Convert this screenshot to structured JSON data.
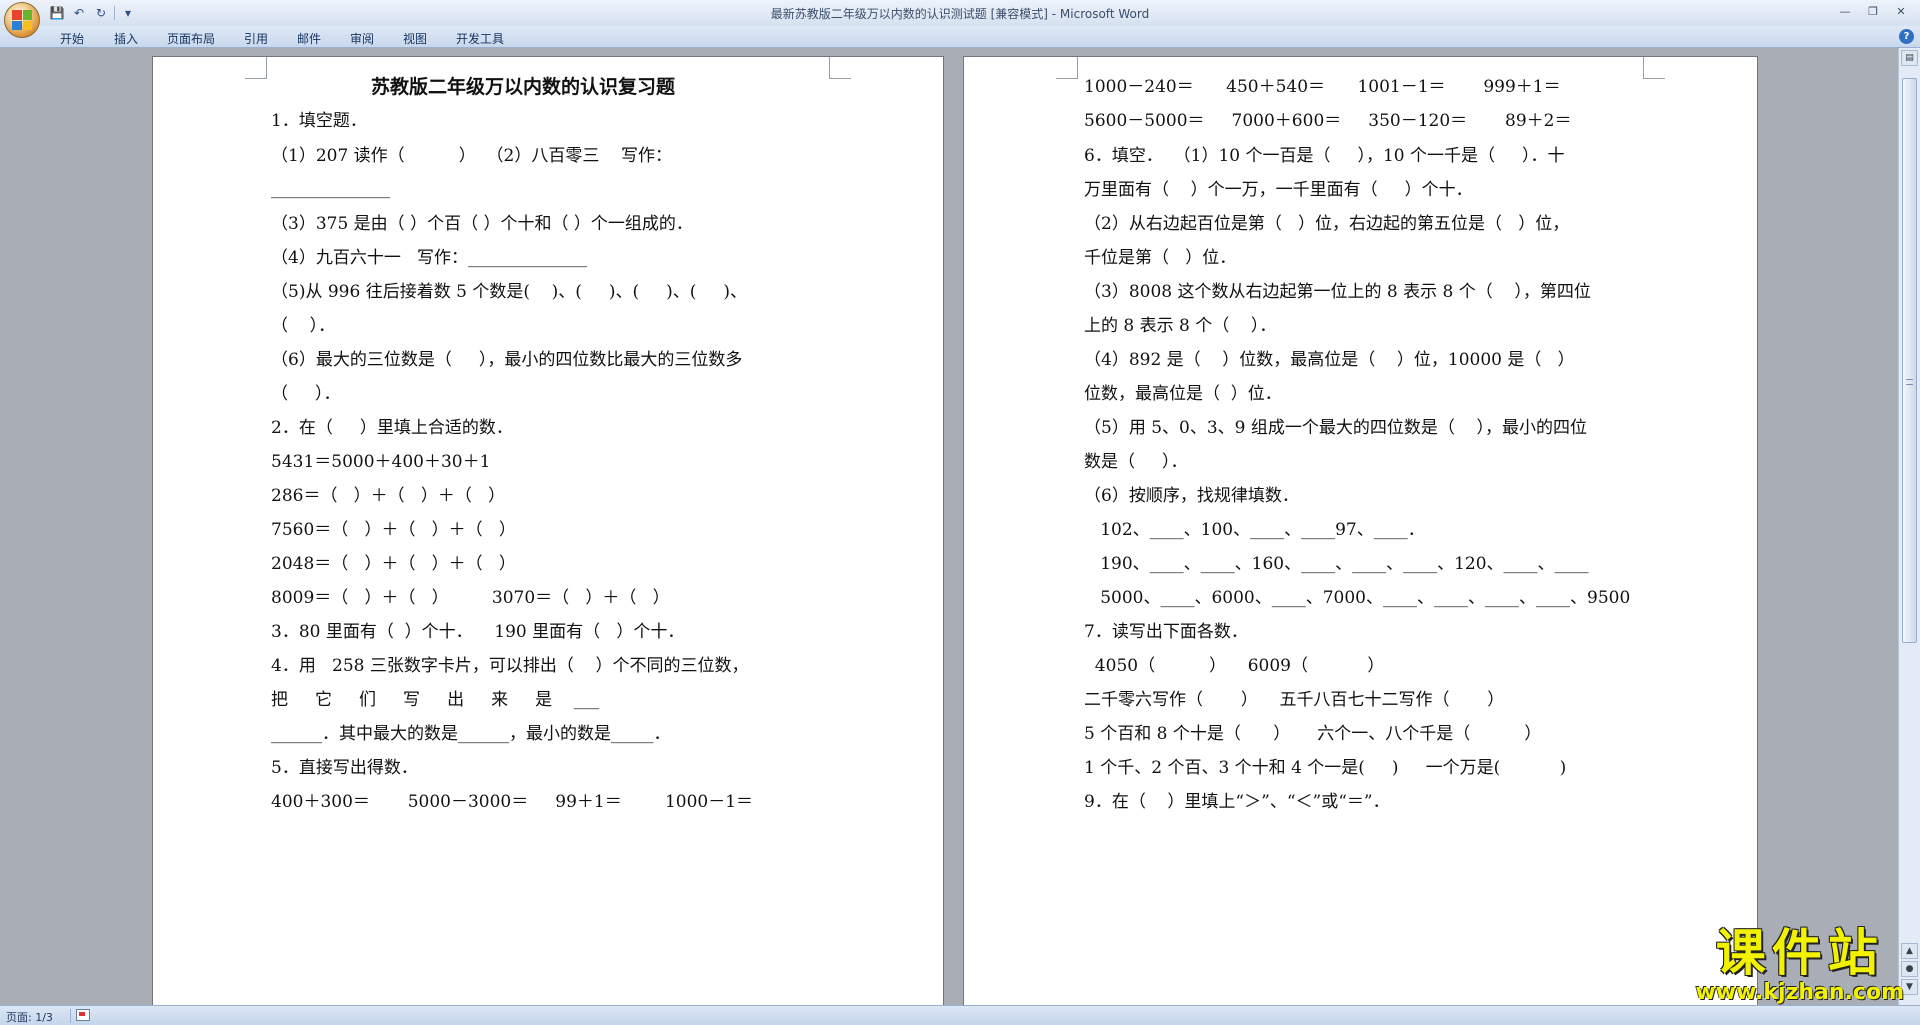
{
  "window": {
    "title": "最新苏教版二年级万以内数的认识测试题 [兼容模式] - Microsoft Word",
    "min_glyph": "—",
    "max_glyph": "❐",
    "close_glyph": "✕"
  },
  "quick_access": {
    "save_glyph": "💾",
    "undo_glyph": "↶",
    "redo_glyph": "↻",
    "more_glyph": "▾"
  },
  "ribbon": {
    "tabs": [
      "开始",
      "插入",
      "页面布局",
      "引用",
      "邮件",
      "审阅",
      "视图",
      "开发工具"
    ],
    "help": "?"
  },
  "document": {
    "left_page": [
      "苏教版二年级万以内数的认识复习题",
      "1．填空题．",
      "（1）207 读作（          ）  （2）八百零三    写作：",
      "______________",
      "（3）375 是由（ ）个百（ ）个十和（ ）个一组成的．",
      "（4）九百六十一   写作：______________",
      "（5)从 996 往后接着数 5 个数是(    )、(     )、(     )、(     )、",
      "（    ）．",
      "（6）最大的三位数是（     ），最小的四位数比最大的三位数多",
      "（     ）．",
      "2．在（     ）里填上合适的数．",
      "5431＝5000＋400＋30＋1",
      "286＝（   ）＋（   ）＋（   ）",
      "7560＝（   ）＋（   ）＋（   ）",
      "2048＝（   ）＋（   ）＋（   ）",
      "8009＝（   ）＋（   ）        3070＝（   ）＋（   ）",
      "3．80 里面有（  ）个十．    190 里面有（   ）个十．",
      "4．用   258 三张数字卡片，可以排出（    ）个不同的三位数，",
      "把     它     们     写     出     来     是    ___",
      "______．其中最大的数是______，最小的数是_____．",
      "5．直接写出得数．",
      "400＋300＝       5000－3000＝     99＋1＝        1000－1＝"
    ],
    "right_page": [
      "1000－240＝      450＋540＝      1001－1＝       999＋1＝",
      "5600－5000＝     7000＋600＝     350－120＝       89＋2＝",
      "6．填空．  （1）10 个一百是（     ），10 个一千是（     ）．十",
      "万里面有（    ）个一万，一千里面有（     ）个十．",
      "（2）从右边起百位是第（   ）位，右边起的第五位是（   ）位，",
      "千位是第（   ）位．",
      "（3）8008 这个数从右边起第一位上的 8 表示 8 个（    ），第四位",
      "上的 8 表示 8 个（    ）．",
      "（4）892 是（    ）位数，最高位是（    ）位，10000 是（   ）",
      "位数，最高位是（  ）位．",
      "（5）用 5、0、3、9 组成一个最大的四位数是（    ），最小的四位",
      "数是（     ）．",
      "（6）按顺序，找规律填数．",
      "   102、____、100、____、____97、____．",
      "   190、____、____、160、____、____、____、120、____、____",
      "   5000、____、6000、____、7000、____、____、____、____、9500",
      "7．读写出下面各数．",
      "  4050（          ）    6009（           ）",
      "二千零六写作（       ）    五千八百七十二写作（       ）",
      "5 个百和 8 个十是（      ）     六个一、八个千是（          ）",
      "1 个千、2 个百、3 个十和 4 个一是(     )     一个万是(           )",
      "9．在（    ）里填上“＞”、“＜”或“＝”．"
    ]
  },
  "status": {
    "page": "页面: 1/3"
  },
  "watermark": {
    "main": "课件站",
    "sub": "www.kjzhan.com"
  }
}
